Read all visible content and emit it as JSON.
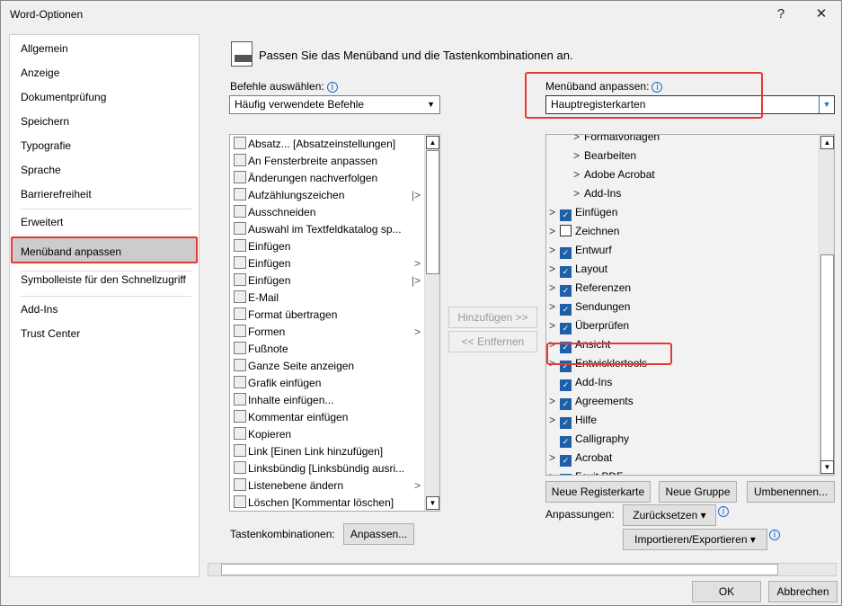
{
  "window": {
    "title": "Word-Optionen",
    "help": "?",
    "close": "✕"
  },
  "nav": {
    "items": [
      "Allgemein",
      "Anzeige",
      "Dokumentprüfung",
      "Speichern",
      "Typografie",
      "Sprache",
      "Barrierefreiheit",
      "Erweitert",
      "Menüband anpassen",
      "Symbolleiste für den Schnellzugriff",
      "Add-Ins",
      "Trust Center"
    ],
    "selected": "Menüband anpassen"
  },
  "header": {
    "title": "Passen Sie das Menüband und die Tastenkombinationen an."
  },
  "commands": {
    "label": "Befehle auswählen:",
    "selected": "Häufig verwendete Befehle",
    "items": [
      {
        "label": "Absatz... [Absatzeinstellungen]",
        "arrow": ""
      },
      {
        "label": "An Fensterbreite anpassen",
        "arrow": ""
      },
      {
        "label": "Änderungen nachverfolgen",
        "arrow": ""
      },
      {
        "label": "Aufzählungszeichen",
        "arrow": "|>"
      },
      {
        "label": "Ausschneiden",
        "arrow": ""
      },
      {
        "label": "Auswahl im Textfeldkatalog sp...",
        "arrow": ""
      },
      {
        "label": "Einfügen",
        "arrow": ""
      },
      {
        "label": "Einfügen",
        "arrow": ">"
      },
      {
        "label": "Einfügen",
        "arrow": "|>"
      },
      {
        "label": "E-Mail",
        "arrow": ""
      },
      {
        "label": "Format übertragen",
        "arrow": ""
      },
      {
        "label": "Formen",
        "arrow": ">"
      },
      {
        "label": "Fußnote",
        "arrow": ""
      },
      {
        "label": "Ganze Seite anzeigen",
        "arrow": ""
      },
      {
        "label": "Grafik einfügen",
        "arrow": ""
      },
      {
        "label": "Inhalte einfügen...",
        "arrow": ""
      },
      {
        "label": "Kommentar einfügen",
        "arrow": ""
      },
      {
        "label": "Kopieren",
        "arrow": ""
      },
      {
        "label": "Link [Einen Link hinzufügen]",
        "arrow": ""
      },
      {
        "label": "Linksbündig [Linksbündig ausri...",
        "arrow": ""
      },
      {
        "label": "Listenebene ändern",
        "arrow": ">"
      },
      {
        "label": "Löschen [Kommentar löschen]",
        "arrow": ""
      }
    ]
  },
  "middle": {
    "add": "Hinzufügen >>",
    "remove": "<< Entfernen"
  },
  "ribbon": {
    "label": "Menüband anpassen:",
    "selected": "Hauptregisterkarten",
    "items": [
      {
        "label": "Formatvorlagen",
        "level": 1,
        "check": null,
        "expand": true
      },
      {
        "label": "Bearbeiten",
        "level": 1,
        "check": null,
        "expand": true
      },
      {
        "label": "Adobe Acrobat",
        "level": 1,
        "check": null,
        "expand": true
      },
      {
        "label": "Add-Ins",
        "level": 1,
        "check": null,
        "expand": true
      },
      {
        "label": "Einfügen",
        "level": 0,
        "check": true,
        "expand": true
      },
      {
        "label": "Zeichnen",
        "level": 0,
        "check": false,
        "expand": true
      },
      {
        "label": "Entwurf",
        "level": 0,
        "check": true,
        "expand": true
      },
      {
        "label": "Layout",
        "level": 0,
        "check": true,
        "expand": true
      },
      {
        "label": "Referenzen",
        "level": 0,
        "check": true,
        "expand": true
      },
      {
        "label": "Sendungen",
        "level": 0,
        "check": true,
        "expand": true
      },
      {
        "label": "Überprüfen",
        "level": 0,
        "check": true,
        "expand": true
      },
      {
        "label": "Ansicht",
        "level": 0,
        "check": true,
        "expand": true
      },
      {
        "label": "Entwicklertools",
        "level": 0,
        "check": true,
        "expand": true
      },
      {
        "label": "Add-Ins",
        "level": 0,
        "check": true,
        "expand": false
      },
      {
        "label": "Agreements",
        "level": 0,
        "check": true,
        "expand": true
      },
      {
        "label": "Hilfe",
        "level": 0,
        "check": true,
        "expand": true
      },
      {
        "label": "Calligraphy",
        "level": 0,
        "check": true,
        "expand": false
      },
      {
        "label": "Acrobat",
        "level": 0,
        "check": true,
        "expand": true
      },
      {
        "label": "Foxit PDF",
        "level": 0,
        "check": true,
        "expand": true
      }
    ],
    "new_tab": "Neue Registerkarte",
    "new_group": "Neue Gruppe",
    "rename": "Umbenennen...",
    "customizations_label": "Anpassungen:",
    "reset": "Zurücksetzen ▾",
    "import_export": "Importieren/Exportieren ▾"
  },
  "shortcuts": {
    "label": "Tastenkombinationen:",
    "customize": "Anpassen..."
  },
  "footer": {
    "ok": "OK",
    "cancel": "Abbrechen"
  },
  "colors": {
    "highlight": "#e53935",
    "check": "#1f5fa8"
  }
}
